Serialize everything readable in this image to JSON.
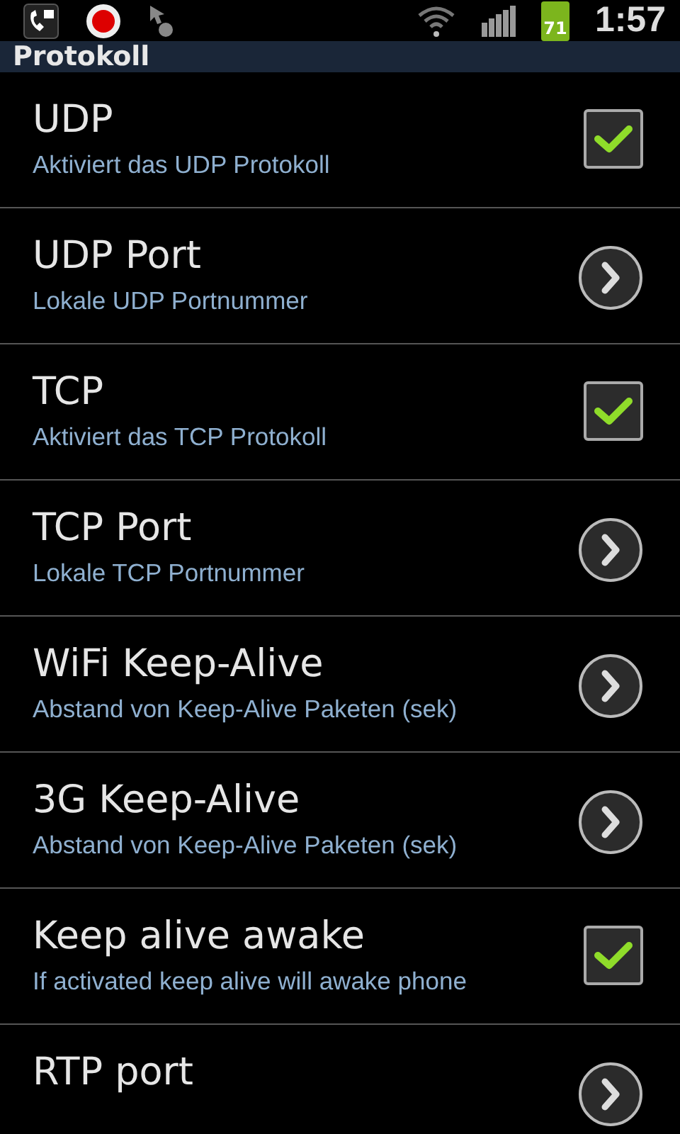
{
  "status_bar": {
    "battery": "71",
    "time": "1:57"
  },
  "header": {
    "title": "Protokoll"
  },
  "items": [
    {
      "kind": "checkbox",
      "title": "UDP",
      "summary": "Aktiviert das UDP Protokoll",
      "checked": true
    },
    {
      "kind": "link",
      "title": "UDP Port",
      "summary": "Lokale UDP Portnummer"
    },
    {
      "kind": "checkbox",
      "title": "TCP",
      "summary": "Aktiviert das TCP Protokoll",
      "checked": true
    },
    {
      "kind": "link",
      "title": "TCP Port",
      "summary": "Lokale TCP Portnummer"
    },
    {
      "kind": "link",
      "title": "WiFi Keep-Alive",
      "summary": "Abstand von Keep-Alive Paketen (sek)"
    },
    {
      "kind": "link",
      "title": "3G Keep-Alive",
      "summary": "Abstand von Keep-Alive Paketen (sek)"
    },
    {
      "kind": "checkbox",
      "title": "Keep alive awake",
      "summary": "If activated keep alive will awake phone",
      "checked": true
    },
    {
      "kind": "link",
      "title": "RTP port"
    }
  ]
}
